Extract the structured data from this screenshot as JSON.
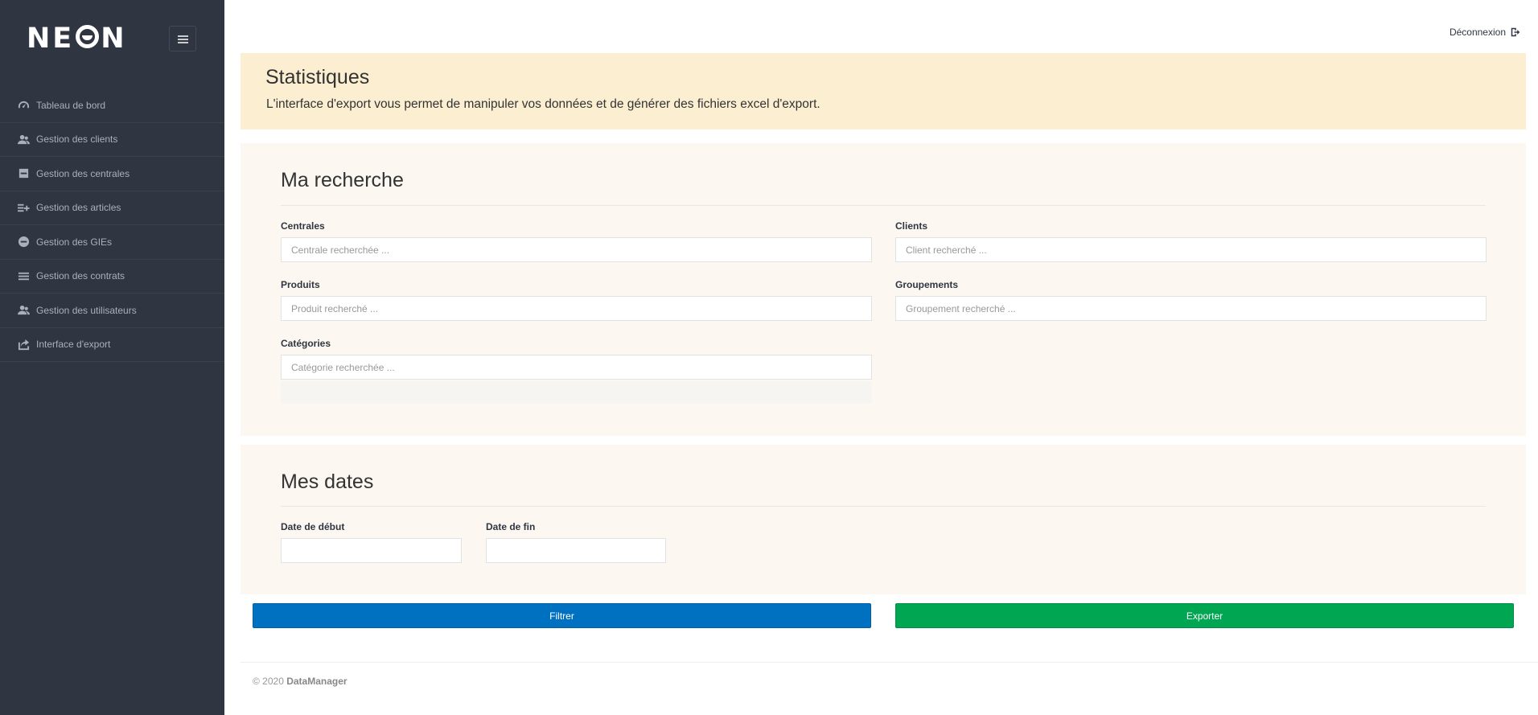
{
  "brand": {
    "logo_text_left": "NE",
    "logo_text_right": "N"
  },
  "sidebar": {
    "items": [
      {
        "label": "Tableau de bord",
        "icon": "gauge-icon"
      },
      {
        "label": "Gestion des clients",
        "icon": "users-icon"
      },
      {
        "label": "Gestion des centrales",
        "icon": "box-icon"
      },
      {
        "label": "Gestion des articles",
        "icon": "list-add-icon"
      },
      {
        "label": "Gestion des GIEs",
        "icon": "minus-circle-icon"
      },
      {
        "label": "Gestion des contrats",
        "icon": "list-icon"
      },
      {
        "label": "Gestion des utilisateurs",
        "icon": "users-icon"
      },
      {
        "label": "Interface d'export",
        "icon": "export-icon"
      }
    ]
  },
  "header": {
    "logout_label": "Déconnexion"
  },
  "banner": {
    "title": "Statistiques",
    "description": "L'interface d'export vous permet de manipuler vos données et de générer des fichiers excel d'export."
  },
  "search": {
    "title": "Ma recherche",
    "centrales": {
      "label": "Centrales",
      "placeholder": "Centrale recherchée ..."
    },
    "clients": {
      "label": "Clients",
      "placeholder": "Client recherché ..."
    },
    "produits": {
      "label": "Produits",
      "placeholder": "Produit recherché ..."
    },
    "groupements": {
      "label": "Groupements",
      "placeholder": "Groupement recherché ..."
    },
    "categories": {
      "label": "Catégories",
      "placeholder": "Catégorie recherchée ..."
    }
  },
  "dates": {
    "title": "Mes dates",
    "start": {
      "label": "Date de début",
      "value": ""
    },
    "end": {
      "label": "Date de fin",
      "value": ""
    }
  },
  "actions": {
    "filter_label": "Filtrer",
    "export_label": "Exporter"
  },
  "footer": {
    "copyright": "© 2020",
    "company": "DataManager"
  },
  "colors": {
    "sidebar_bg": "#303641",
    "banner_bg": "#fcefd1",
    "panel_bg": "#fcf8f1",
    "filter_button": "#0071c1",
    "export_button": "#00a651"
  }
}
